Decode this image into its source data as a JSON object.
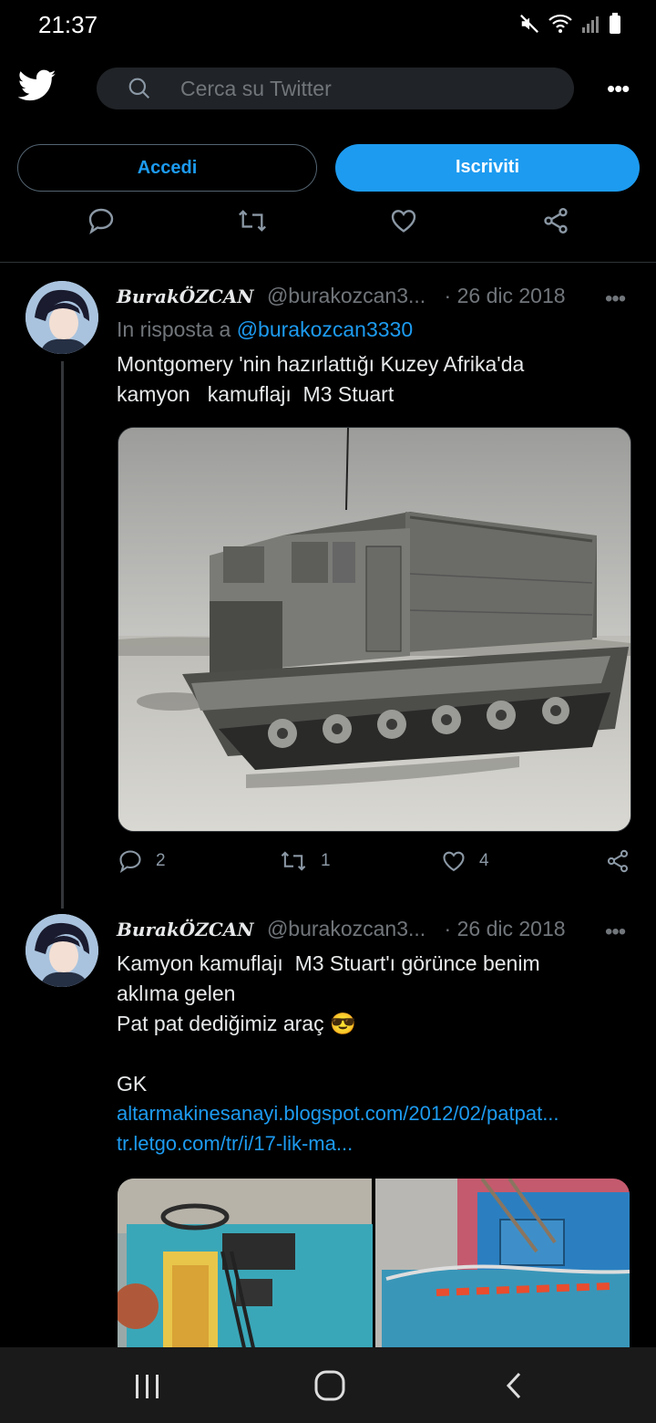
{
  "status": {
    "time": "21:37"
  },
  "header": {
    "search_placeholder": "Cerca su Twitter",
    "more": "•••"
  },
  "auth": {
    "login_label": "Accedi",
    "signup_label": "Iscriviti"
  },
  "tweets": [
    {
      "display_name": "BurakÖZCAN",
      "handle": "@burakozcan3...",
      "date": "· 26 dic 2018",
      "reply_prefix": "In risposta a",
      "reply_handle": "@burakozcan3330",
      "text": "Montgomery 'nin hazırlattığı Kuzey Afrika'da\nkamyon   kamuflajı  M3 Stuart",
      "stats": {
        "replies": "2",
        "retweets": "1",
        "likes": "4"
      }
    },
    {
      "display_name": "BurakÖZCAN",
      "handle": "@burakozcan3...",
      "date": "· 26 dic 2018",
      "text": "Kamyon kamuflajı  M3 Stuart'ı görünce benim\naklıma gelen\nPat pat dediğimiz araç 😎\n\nGK",
      "links": [
        "altarmakinesanayi.blogspot.com/2012/02/patpat...",
        "tr.letgo.com/tr/i/17-lik-ma..."
      ]
    }
  ]
}
